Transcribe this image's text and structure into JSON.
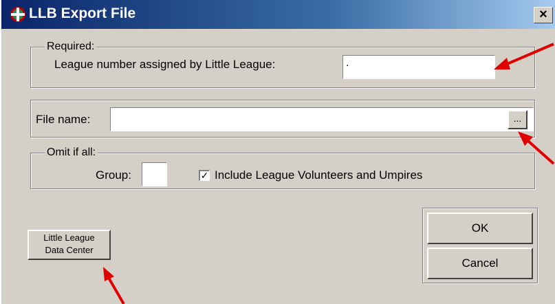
{
  "window": {
    "title": "LLB Export File",
    "close_glyph": "×",
    "icon": "app-logo-icon"
  },
  "required": {
    "legend": "Required:",
    "league_label": "League number assigned by Little League:",
    "league_value": "."
  },
  "file": {
    "label": "File name:",
    "value": "",
    "browse_label": "..."
  },
  "omit": {
    "legend": "Omit if all:",
    "group_label": "Group:",
    "group_value": "",
    "include_label": "Include League Volunteers and Umpires",
    "include_checked": true
  },
  "buttons": {
    "data_center_line1": "Little League",
    "data_center_line2": "Data Center",
    "ok": "OK",
    "cancel": "Cancel"
  },
  "annotation_color": "#e00000"
}
